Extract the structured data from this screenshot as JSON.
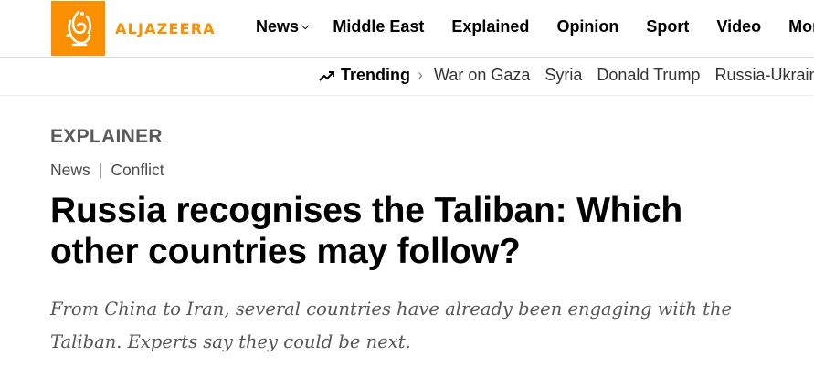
{
  "header": {
    "logo_text": "ALJAZEERA",
    "brand_color": "#fa9000",
    "nav": [
      {
        "label": "News",
        "has_dropdown": true
      },
      {
        "label": "Middle East"
      },
      {
        "label": "Explained"
      },
      {
        "label": "Opinion"
      },
      {
        "label": "Sport"
      },
      {
        "label": "Video"
      },
      {
        "label": "More",
        "has_dropdown": true
      }
    ],
    "dropdown_icon": "chevron-down-icon"
  },
  "trending": {
    "label": "Trending",
    "icon": "trending-up-icon",
    "separator_icon": "chevron-right-icon",
    "links": [
      "War on Gaza",
      "Syria",
      "Donald Trump",
      "Russia-Ukraine"
    ]
  },
  "article": {
    "kicker": "EXPLAINER",
    "breadcrumbs": [
      "News",
      "Conflict"
    ],
    "breadcrumb_separator": "|",
    "headline": "Russia recognises the Taliban: Which other countries may follow?",
    "dek": "From China to Iran, several countries have already been engaging with the Taliban. Experts say they could be next."
  }
}
